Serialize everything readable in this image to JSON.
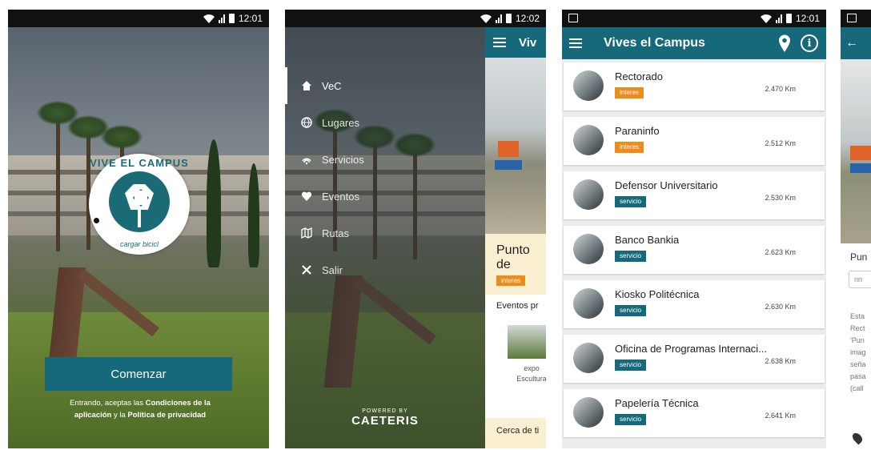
{
  "status_bar": {
    "time_1": "12:01",
    "time_2": "12:02",
    "time_3": "12:01"
  },
  "screen1": {
    "logo_top": "VIVE EL CAMPUS",
    "logo_bottom": "cargar bicicl",
    "start_button": "Comenzar",
    "legal_1": "Entrando, aceptas las ",
    "legal_terms": "Condiciones de la aplicación",
    "legal_2": " y la ",
    "legal_privacy": "Política de privacidad"
  },
  "screen2": {
    "menu": [
      {
        "label": "VeC",
        "icon": "home-icon"
      },
      {
        "label": "Lugares",
        "icon": "globe-icon"
      },
      {
        "label": "Servicios",
        "icon": "wifi-icon"
      },
      {
        "label": "Eventos",
        "icon": "heart-icon"
      },
      {
        "label": "Rutas",
        "icon": "map-icon"
      },
      {
        "label": "Salir",
        "icon": "close-icon"
      }
    ],
    "powered_by": "POWERED BY",
    "brand": "CAETERIS",
    "under_title": "Viv",
    "under_place": "Punto de",
    "under_tag": "interes",
    "under_events": "Eventos pr",
    "under_caption_1": "expo",
    "under_caption_2": "Escultura",
    "under_cerca": "Cerca de ti"
  },
  "screen3": {
    "title": "Vives el Campus",
    "places": [
      {
        "name": "Rectorado",
        "tag": "interes",
        "distance": "2.470 Km"
      },
      {
        "name": "Paraninfo",
        "tag": "interes",
        "distance": "2.512 Km"
      },
      {
        "name": "Defensor Universitario",
        "tag": "servicio",
        "distance": "2.530 Km"
      },
      {
        "name": "Banco Bankia",
        "tag": "servicio",
        "distance": "2.623 Km"
      },
      {
        "name": "Kiosko Politécnica",
        "tag": "servicio",
        "distance": "2.630 Km"
      },
      {
        "name": "Oficina de Programas Internaci...",
        "tag": "servicio",
        "distance": "2.638 Km"
      },
      {
        "name": "Papelería Técnica",
        "tag": "servicio",
        "distance": "2.641 Km"
      }
    ]
  },
  "screen4": {
    "place_title": "Pun",
    "input_placeholder": "nn",
    "text_lines": [
      "Esta",
      "Rect",
      "'Pun",
      "imag",
      "seña",
      "pasa",
      "(call"
    ]
  },
  "colors": {
    "primary": "#15697a",
    "interes": "#ee8c1b",
    "servicio": "#15697a",
    "panel": "#fbefd1"
  }
}
